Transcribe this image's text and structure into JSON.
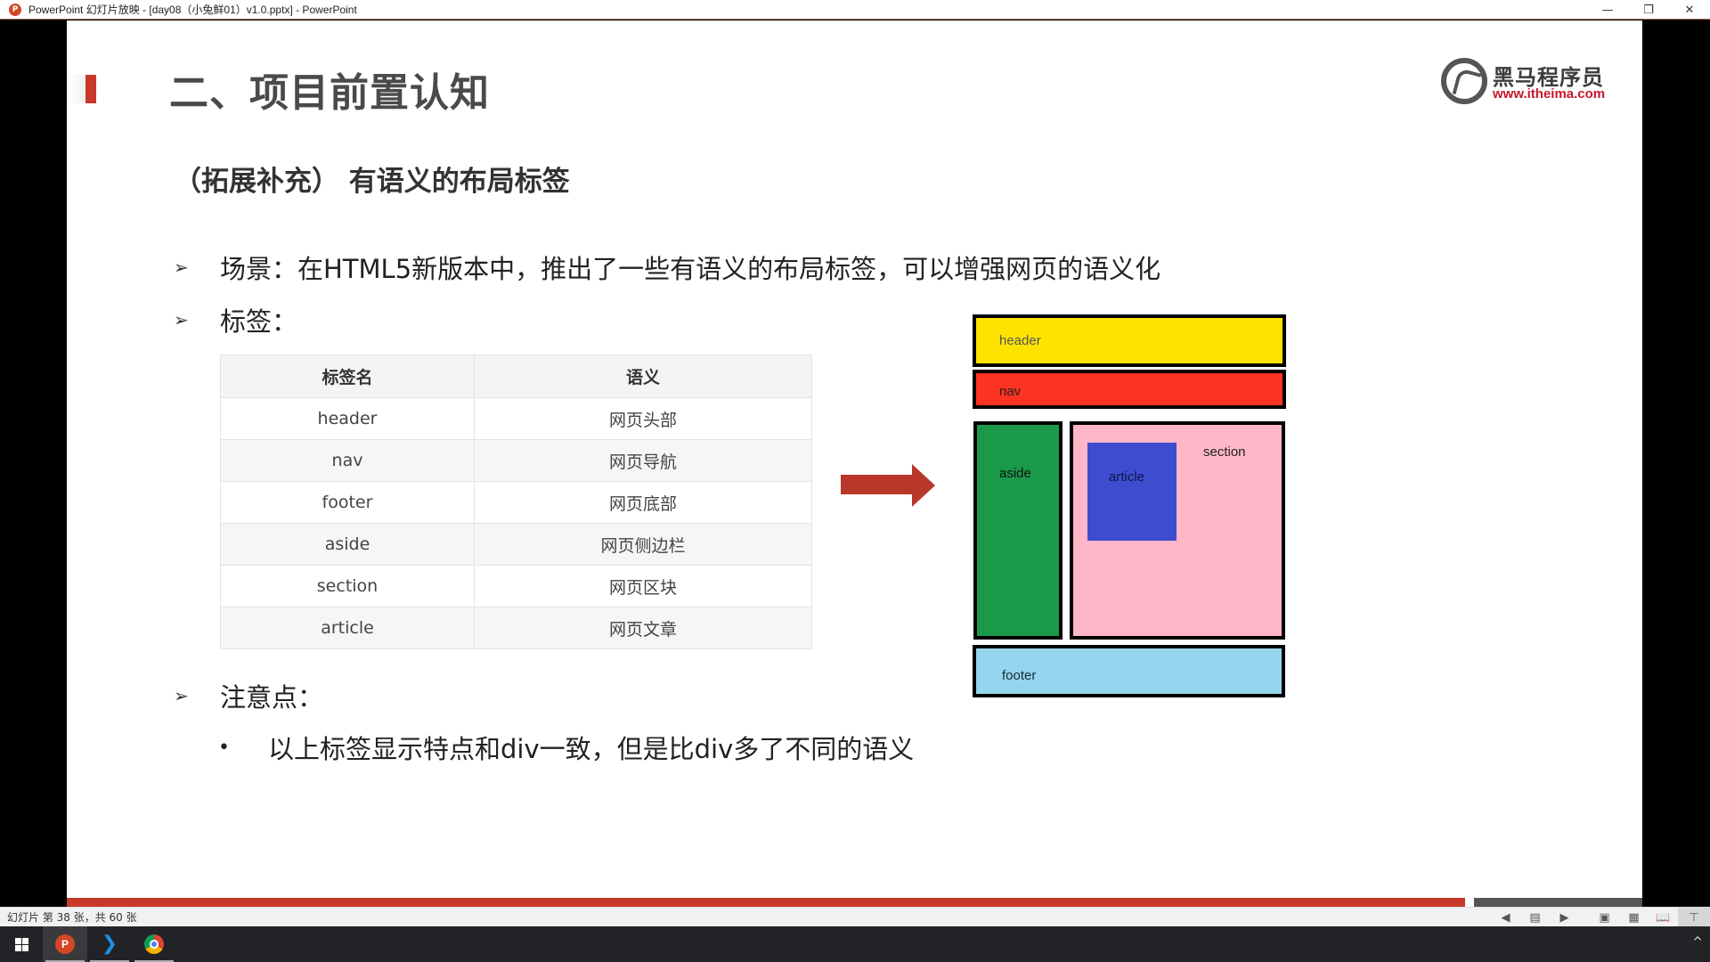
{
  "window": {
    "title": "PowerPoint 幻灯片放映 - [day08（小兔鲜01）v1.0.pptx] - PowerPoint",
    "app_icon_label": "P",
    "minimize": "—",
    "restore": "❐",
    "close": "✕"
  },
  "slide": {
    "title": "二、项目前置认知",
    "logo": {
      "cn": "黑马程序员",
      "url": "www.itheima.com"
    },
    "subtitle": "（拓展补充） 有语义的布局标签",
    "bullets": [
      {
        "marker": "➢",
        "text": "场景：在HTML5新版本中，推出了一些有语义的布局标签，可以增强网页的语义化"
      },
      {
        "marker": "➢",
        "text": "标签："
      },
      {
        "marker": "➢",
        "text": "注意点："
      }
    ],
    "sub_bullet": {
      "marker": "•",
      "text": "以上标签显示特点和div一致，但是比div多了不同的语义"
    },
    "table": {
      "headers": [
        "标签名",
        "语义"
      ],
      "rows": [
        [
          "header",
          "网页头部"
        ],
        [
          "nav",
          "网页导航"
        ],
        [
          "footer",
          "网页底部"
        ],
        [
          "aside",
          "网页侧边栏"
        ],
        [
          "section",
          "网页区块"
        ],
        [
          "article",
          "网页文章"
        ]
      ]
    },
    "layout_diagram": {
      "header": {
        "label": "header",
        "color": "#ffe300"
      },
      "nav": {
        "label": "nav",
        "color": "#ff3322"
      },
      "aside": {
        "label": "aside",
        "color": "#1a9a48"
      },
      "section": {
        "label": "section",
        "color": "#ffb6c8"
      },
      "article": {
        "label": "article",
        "color": "#3e4ccf"
      },
      "footer": {
        "label": "footer",
        "color": "#95d5ee"
      }
    },
    "arrow_color": "#b8372a",
    "accent_color": "#c6382a"
  },
  "statusbar": {
    "slide_count": "幻灯片 第 38 张，共 60 张",
    "controls": [
      {
        "name": "previous-icon",
        "glyph": "◀"
      },
      {
        "name": "menu-icon",
        "glyph": "▤"
      },
      {
        "name": "next-icon",
        "glyph": "▶"
      },
      {
        "name": "normal-view-icon",
        "glyph": "▣"
      },
      {
        "name": "slide-sorter-icon",
        "glyph": "▦"
      },
      {
        "name": "reading-view-icon",
        "glyph": "📖"
      },
      {
        "name": "slideshow-icon",
        "glyph": "⊤"
      }
    ]
  },
  "taskbar": {
    "ppt_label": "P",
    "vscode_label": "❮❯",
    "tray_up": "^"
  }
}
